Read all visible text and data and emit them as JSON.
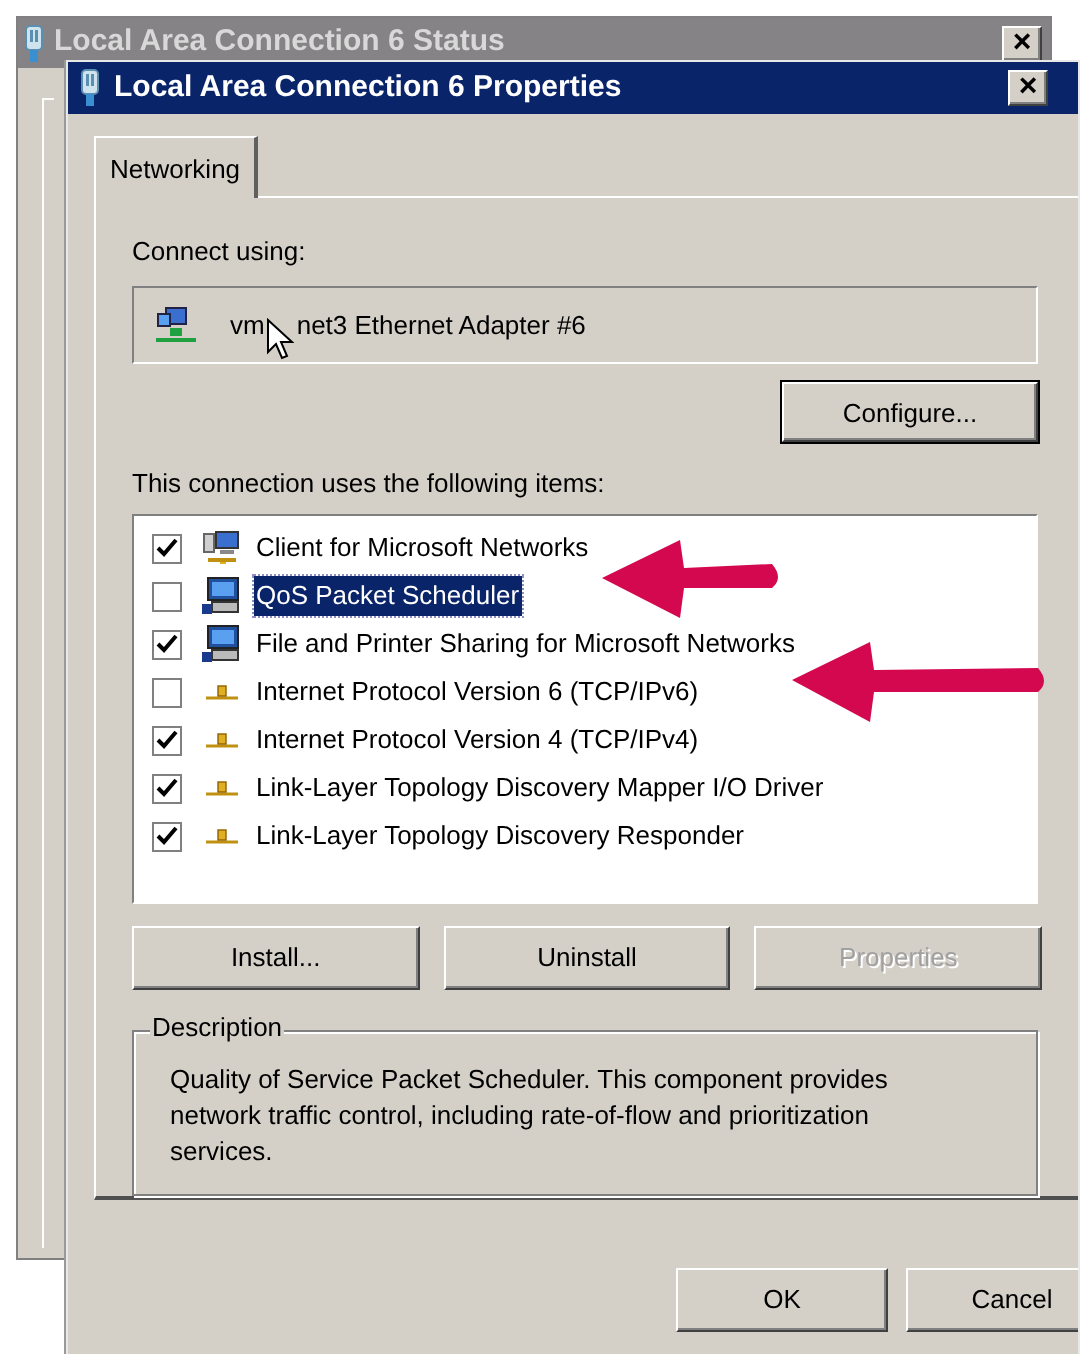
{
  "back_window": {
    "title": "Local Area Connection 6 Status",
    "close": "×"
  },
  "window": {
    "title": "Local Area Connection 6 Properties",
    "close": "×"
  },
  "tabs": [
    {
      "label": "Networking",
      "selected": true
    }
  ],
  "connect_using": {
    "label": "Connect using:",
    "adapter_start": "vm",
    "adapter_end": "net3 Ethernet Adapter #6",
    "configure": "Configure..."
  },
  "items_label": "This connection uses the following items:",
  "items": [
    {
      "label": "Client for Microsoft Networks",
      "kind": "client",
      "checked": true,
      "selected": false
    },
    {
      "label": "QoS Packet Scheduler",
      "kind": "service",
      "checked": false,
      "selected": true
    },
    {
      "label": "File and Printer Sharing for Microsoft Networks",
      "kind": "service",
      "checked": true,
      "selected": false
    },
    {
      "label": "Internet Protocol Version 6 (TCP/IPv6)",
      "kind": "protocol",
      "checked": false,
      "selected": false
    },
    {
      "label": "Internet Protocol Version 4 (TCP/IPv4)",
      "kind": "protocol",
      "checked": true,
      "selected": false
    },
    {
      "label": "Link-Layer Topology Discovery Mapper I/O Driver",
      "kind": "protocol",
      "checked": true,
      "selected": false
    },
    {
      "label": "Link-Layer Topology Discovery Responder",
      "kind": "protocol",
      "checked": true,
      "selected": false
    }
  ],
  "item_buttons": [
    {
      "label": "Install...",
      "disabled": false
    },
    {
      "label": "Uninstall",
      "disabled": false
    },
    {
      "label": "Properties",
      "disabled": true
    }
  ],
  "description": {
    "title": "Description",
    "text": "Quality of Service Packet Scheduler.  This component provides network traffic control, including rate-of-flow and prioritization services."
  },
  "dialog_buttons": [
    "OK",
    "Cancel"
  ]
}
